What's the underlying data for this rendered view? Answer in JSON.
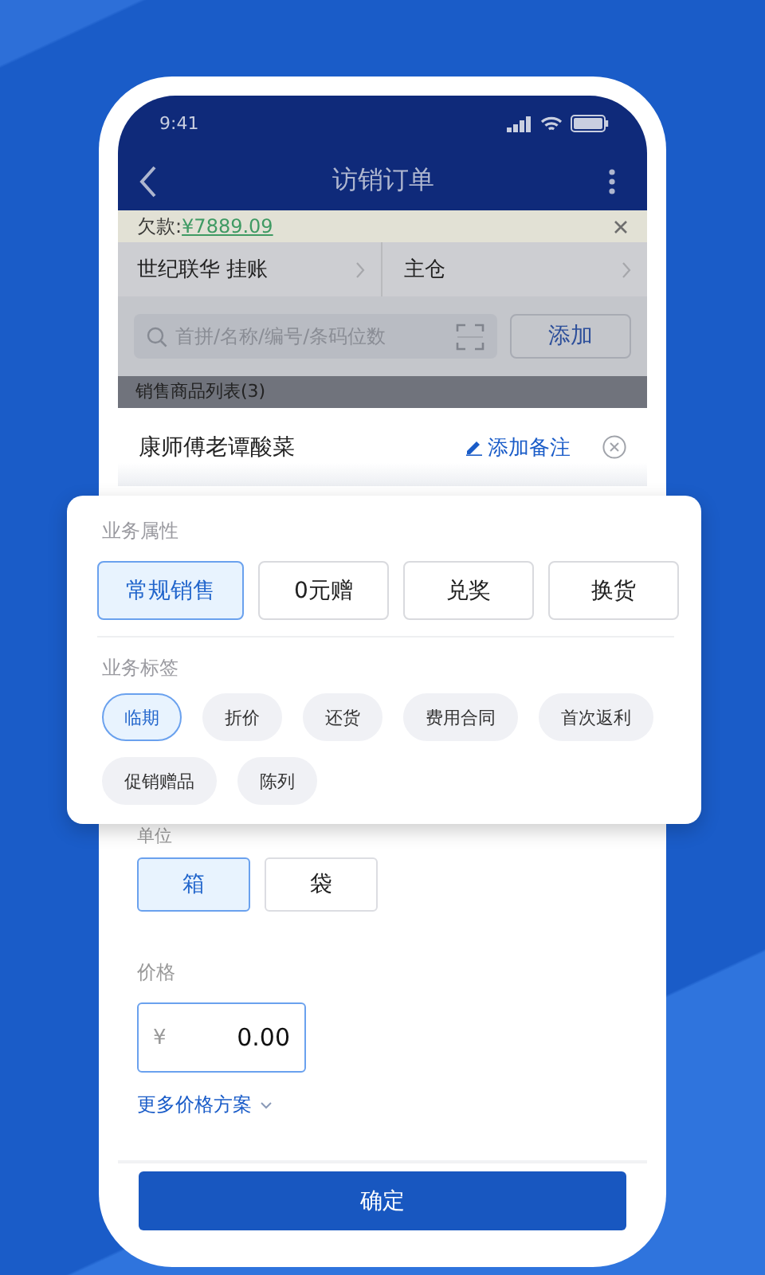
{
  "status_bar": {
    "time": "9:41"
  },
  "nav": {
    "title": "访销订单"
  },
  "debt_banner": {
    "label": "欠款:",
    "amount": "¥7889.09"
  },
  "selectors": [
    {
      "text": "世纪联华 挂账"
    },
    {
      "text": "主仓"
    }
  ],
  "search": {
    "placeholder": "首拼/名称/编号/条码位数",
    "button": "添加"
  },
  "list_header": "销售商品列表(3)",
  "sheet": {
    "product": "康师傅老谭酸菜",
    "note_link": "添加备注"
  },
  "business_attributes": {
    "label": "业务属性",
    "options": [
      {
        "label": "常规销售",
        "selected": true
      },
      {
        "label": "0元赠",
        "selected": false
      },
      {
        "label": "兑奖",
        "selected": false
      },
      {
        "label": "换货",
        "selected": false
      }
    ]
  },
  "business_tags": {
    "label": "业务标签",
    "tags": [
      {
        "label": "临期",
        "selected": true
      },
      {
        "label": "折价",
        "selected": false
      },
      {
        "label": "还货",
        "selected": false
      },
      {
        "label": "费用合同",
        "selected": false
      },
      {
        "label": "首次返利",
        "selected": false
      },
      {
        "label": "促销赠品",
        "selected": false
      },
      {
        "label": "陈列",
        "selected": false
      }
    ]
  },
  "unit": {
    "label": "单位",
    "options": [
      {
        "label": "箱",
        "selected": true
      },
      {
        "label": "袋",
        "selected": false
      }
    ]
  },
  "price": {
    "label": "价格",
    "currency": "¥",
    "value": "0.00"
  },
  "more_prices": "更多价格方案",
  "confirm": "确定"
}
